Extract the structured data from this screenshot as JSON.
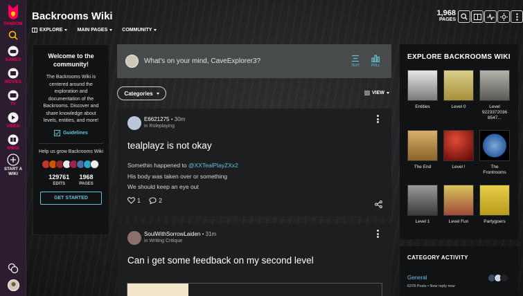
{
  "rail": {
    "logo_label": "FANDOM",
    "items": [
      {
        "label": "GAMES"
      },
      {
        "label": "MOVIES"
      },
      {
        "label": "TV"
      },
      {
        "label": "VIDEO"
      },
      {
        "label": "WIKIS"
      },
      {
        "label": "START A WIKI"
      }
    ]
  },
  "header": {
    "title": "Backrooms Wiki",
    "nav": [
      "EXPLORE",
      "MAIN PAGES",
      "COMMUNITY"
    ],
    "pages_count": "1,968",
    "pages_label": "PAGES"
  },
  "welcome": {
    "title": "Welcome to the community!",
    "description": "The Backrooms Wiki is centered around the exploration and documentation of the Backrooms. Discover and share knowledge about levels, entities, and more!",
    "guidelines": "Guidelines",
    "help": "Help us grow Backrooms Wiki",
    "edits_value": "129761",
    "edits_label": "EDITS",
    "pages_value": "1968",
    "pages_label": "PAGES",
    "cta": "GET STARTED"
  },
  "composer": {
    "placeholder": "What's on your mind, CaveExplorer3?",
    "text_label": "TEXT",
    "poll_label": "POLL"
  },
  "filters": {
    "categories": "Categories",
    "view": "VIEW"
  },
  "posts": [
    {
      "user": "E6621275",
      "time": "30m",
      "category": "in Roleplaying",
      "title": "tealplayz is not okay",
      "body_prefix": "Somethin happened to ",
      "mention": "@XXTealPlayZXx2",
      "body_lines": [
        "His body was taken over or something",
        "We should keep an eye out"
      ],
      "likes": "1",
      "comments": "2"
    },
    {
      "user": "SoulWithSorrowLaiden",
      "time": "31m",
      "category": "in Writing Critique",
      "title": "Can i get some feedback on my second level"
    }
  ],
  "explore": {
    "title": "EXPLORE BACKROOMS WIKI",
    "tiles": [
      {
        "label": "Entities",
        "color": "#bdbdbd"
      },
      {
        "label": "Level 0",
        "color": "#c8b25a"
      },
      {
        "label": "Level 9223372036 8547...",
        "color": "#8a8a86"
      },
      {
        "label": "The End",
        "color": "#b98a3a"
      },
      {
        "label": "Level !",
        "color": "#a8130f"
      },
      {
        "label": "The Frontrooms",
        "color": "#2d5fa3"
      },
      {
        "label": "Level 1",
        "color": "#707070"
      },
      {
        "label": "Level Fun",
        "color": "#c4ad45"
      },
      {
        "label": "Partygoers",
        "color": "#d1b329"
      }
    ]
  },
  "activity": {
    "title": "CATEGORY ACTIVITY",
    "category": "General",
    "meta": "6378 Posts • New reply now"
  },
  "colors": {
    "accent": "#63c3e0",
    "fandom_pink": "#fa005a",
    "rail_bg": "#2b1d2e"
  }
}
